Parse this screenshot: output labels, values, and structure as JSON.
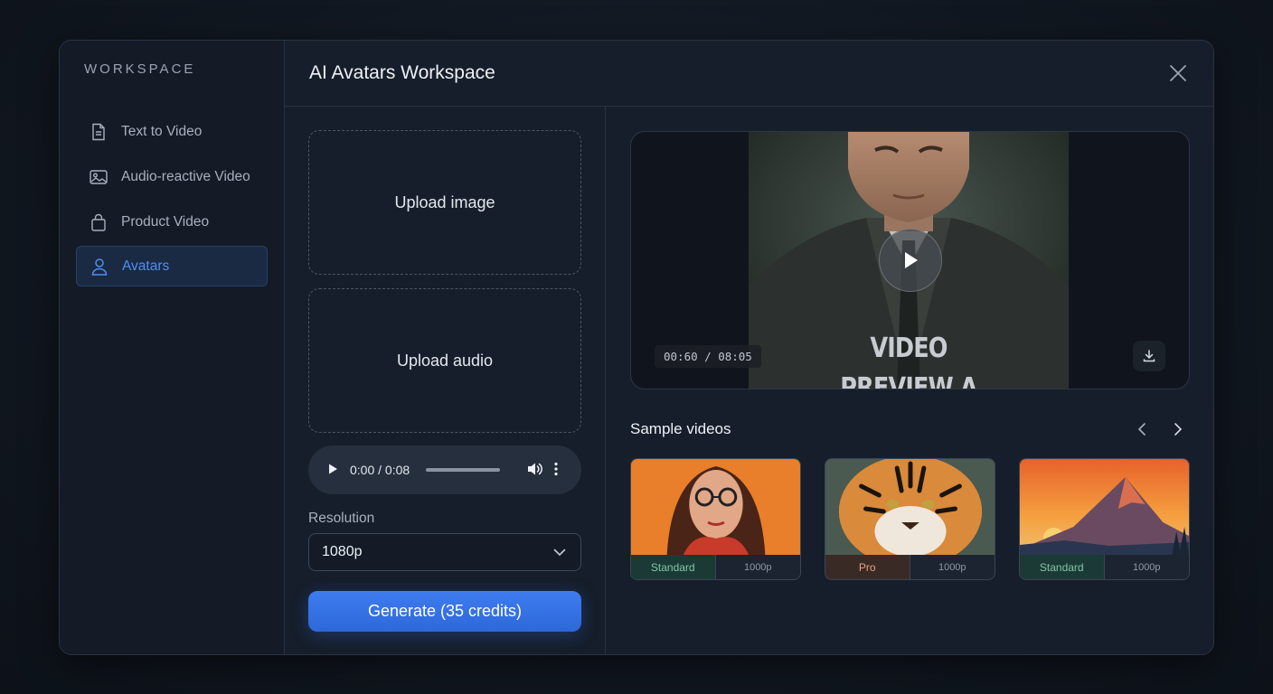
{
  "sidebar": {
    "title": "WORKSPACE",
    "items": [
      {
        "label": "Text to Video",
        "icon": "document-icon"
      },
      {
        "label": "Audio-reactive Video",
        "icon": "image-icon"
      },
      {
        "label": "Product Video",
        "icon": "shopping-bag-icon"
      },
      {
        "label": "Avatars",
        "icon": "user-icon",
        "active": true
      }
    ]
  },
  "header": {
    "title": "AI Avatars Workspace"
  },
  "upload": {
    "image_label": "Upload image",
    "audio_label": "Upload audio"
  },
  "audio_player": {
    "time": "0:00 / 0:08"
  },
  "resolution": {
    "label": "Resolution",
    "value": "1080p"
  },
  "generate": {
    "label": "Generate (35 credits)"
  },
  "preview": {
    "overlay_line1": "VIDEO",
    "overlay_line2": "PREVIEW A",
    "timecode": "00:60 / 08:05"
  },
  "samples": {
    "title": "Sample videos",
    "items": [
      {
        "tier": "Standard",
        "resolution": "1000p",
        "tier_color": "#7fc7a6",
        "tier_bg": "#1c3a35"
      },
      {
        "tier": "Pro",
        "resolution": "1000p",
        "tier_color": "#e8a27a",
        "tier_bg": "#3a2a26"
      },
      {
        "tier": "Standard",
        "resolution": "1000p",
        "tier_color": "#7fc7a6",
        "tier_bg": "#1c3a35"
      }
    ]
  },
  "colors": {
    "accent": "#3d7cf0",
    "active_nav": "#4f8ef0",
    "background": "#161e2b"
  }
}
